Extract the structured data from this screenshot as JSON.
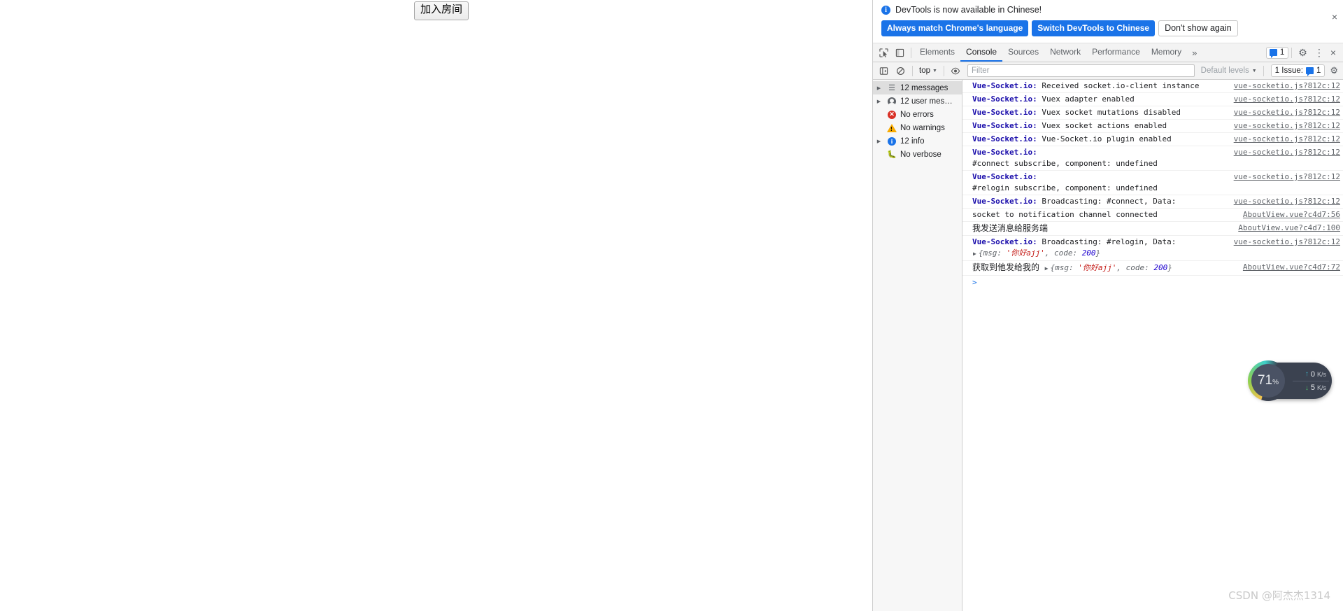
{
  "page": {
    "join_room_button": "加入房间"
  },
  "devtools": {
    "language_banner": {
      "info_icon": "info-icon",
      "message": "DevTools is now available in Chinese!",
      "buttons": {
        "always_match": "Always match Chrome's language",
        "switch_to_chinese": "Switch DevTools to Chinese",
        "dont_show_again": "Don't show again"
      },
      "close_icon": "×"
    },
    "tabstrip": {
      "inspect_icon": "inspect-element-icon",
      "device_toolbar_icon": "device-toolbar-icon",
      "tabs": [
        {
          "label": "Elements",
          "active": false
        },
        {
          "label": "Console",
          "active": true
        },
        {
          "label": "Sources",
          "active": false
        },
        {
          "label": "Network",
          "active": false
        },
        {
          "label": "Performance",
          "active": false
        },
        {
          "label": "Memory",
          "active": false
        }
      ],
      "more_tabs": "»",
      "issues_count": "1",
      "settings_icon": "gear-icon",
      "more_icon": "kebab-menu-icon",
      "close_icon": "×"
    },
    "filterbar": {
      "sidebar_toggle_icon": "console-sidebar-toggle-icon",
      "clear_icon": "clear-console-icon",
      "context": "top",
      "eye_icon": "live-expression-icon",
      "filter_placeholder": "Filter",
      "filter_value": "",
      "levels": "Default levels",
      "issues_label": "1 Issue:",
      "issues_count": "1",
      "settings_icon": "gear-icon"
    },
    "sidebar": [
      {
        "label": "12 messages",
        "icon": "list-icon",
        "arrow": true,
        "selected": true
      },
      {
        "label": "12 user mes…",
        "icon": "user-icon",
        "arrow": true,
        "selected": false
      },
      {
        "label": "No errors",
        "icon": "error-icon",
        "arrow": false,
        "selected": false
      },
      {
        "label": "No warnings",
        "icon": "warning-icon",
        "arrow": false,
        "selected": false
      },
      {
        "label": "12 info",
        "icon": "info-icon",
        "arrow": true,
        "selected": false
      },
      {
        "label": "No verbose",
        "icon": "bug-icon",
        "arrow": false,
        "selected": false
      }
    ],
    "messages": [
      {
        "tag": "Vue-Socket.io:",
        "text": " Received socket.io-client instance",
        "source": "vue-socketio.js?812c:12"
      },
      {
        "tag": "Vue-Socket.io:",
        "text": " Vuex adapter enabled",
        "source": "vue-socketio.js?812c:12"
      },
      {
        "tag": "Vue-Socket.io:",
        "text": " Vuex socket mutations disabled",
        "source": "vue-socketio.js?812c:12"
      },
      {
        "tag": "Vue-Socket.io:",
        "text": " Vuex socket actions enabled",
        "source": "vue-socketio.js?812c:12"
      },
      {
        "tag": "Vue-Socket.io:",
        "text": " Vue-Socket.io plugin enabled",
        "source": "vue-socketio.js?812c:12"
      },
      {
        "tag": "Vue-Socket.io:",
        "text": "\n#connect subscribe, component: undefined",
        "source": "vue-socketio.js?812c:12"
      },
      {
        "tag": "Vue-Socket.io:",
        "text": "\n#relogin subscribe, component: undefined",
        "source": "vue-socketio.js?812c:12"
      },
      {
        "tag": "Vue-Socket.io:",
        "text": " Broadcasting: #connect, Data:",
        "source": "vue-socketio.js?812c:12"
      },
      {
        "tag": "",
        "text": "socket to notification channel connected",
        "source": "AboutView.vue?c4d7:56"
      },
      {
        "tag": "",
        "text": "我发送消息给服务端",
        "chinese": true,
        "source": "AboutView.vue?c4d7:100"
      },
      {
        "tag": "Vue-Socket.io:",
        "text": " Broadcasting: #relogin, Data:",
        "source": "vue-socketio.js?812c:12",
        "object": {
          "prefix": "{msg: ",
          "string": "'你好ajj'",
          "mid": ", code: ",
          "number": "200",
          "suffix": "}"
        },
        "object_on_new_line": true
      },
      {
        "tag": "",
        "text": "获取到他发给我的",
        "chinese": true,
        "source": "AboutView.vue?c4d7:72",
        "object": {
          "prefix": "{msg: ",
          "string": "'你好ajj'",
          "mid": ", code: ",
          "number": "200",
          "suffix": "}"
        },
        "object_on_new_line": false
      }
    ],
    "prompt_chevron": ">"
  },
  "netspeed": {
    "percent": "71",
    "percent_unit": "%",
    "upload_value": "0",
    "upload_unit": "K/s",
    "download_value": "5",
    "download_unit": "K/s",
    "up_arrow": "↑",
    "down_arrow": "↓"
  },
  "watermark": "CSDN @阿杰杰1314",
  "colors": {
    "accent_blue": "#1a73e8",
    "link_blue": "#1a0dab",
    "error_red": "#d93025",
    "warning_yellow": "#f9ab00",
    "string_red": "#c41a16",
    "number_blue": "#1c00cf"
  }
}
